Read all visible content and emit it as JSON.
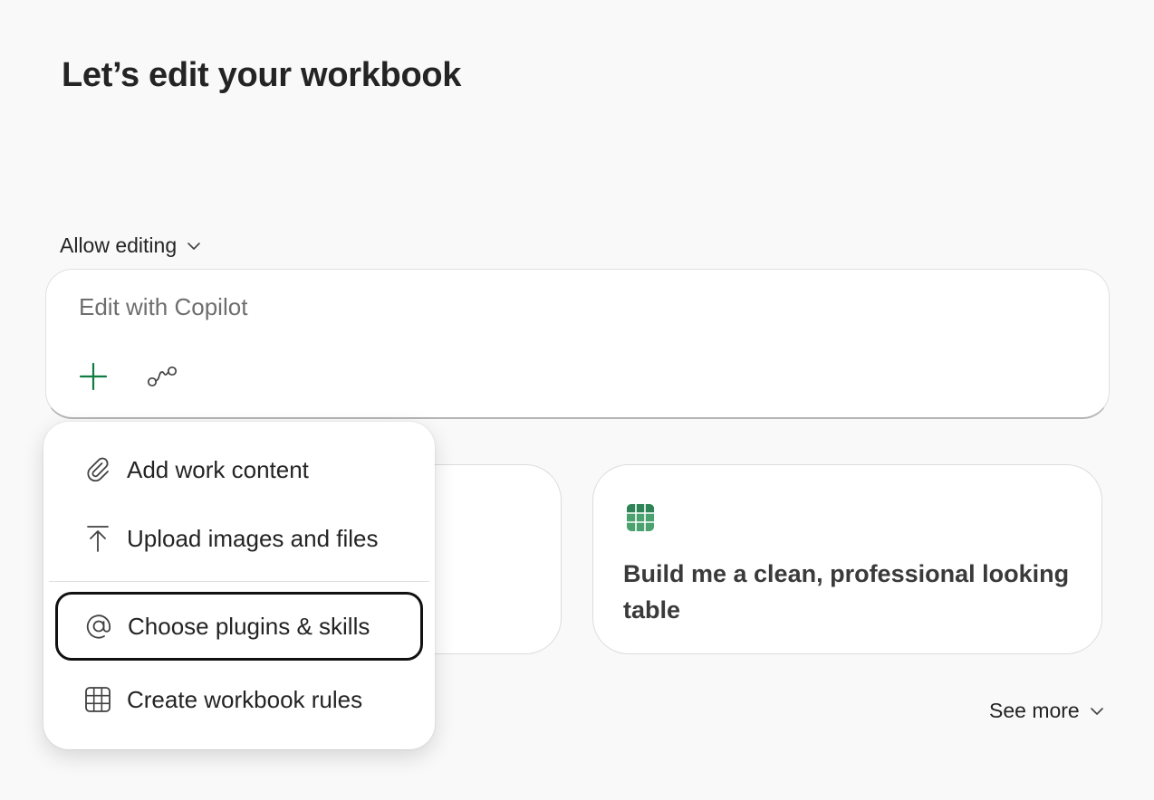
{
  "page": {
    "title": "Let’s edit your workbook"
  },
  "mode": {
    "label": "Allow editing",
    "icon": "chevron-down-icon"
  },
  "composer": {
    "placeholder": "Edit with Copilot",
    "value": "",
    "add_icon": "plus-icon",
    "flow_icon": "flow-icon",
    "accent_color": "#107c41"
  },
  "cards": [
    {
      "text": ""
    },
    {
      "icon": "grid-table-icon",
      "text": "Build me a clean, professional looking table",
      "icon_color": "#4ba26f"
    }
  ],
  "see_more": {
    "label": "See more",
    "icon": "chevron-down-icon"
  },
  "menu": {
    "items": [
      {
        "label": "Add work content",
        "icon": "paperclip-icon"
      },
      {
        "label": "Upload images and files",
        "icon": "upload-icon"
      },
      {
        "label": "Choose plugins & skills",
        "icon": "at-sign-icon",
        "focused": true
      },
      {
        "label": "Create workbook rules",
        "icon": "table-grid-icon"
      }
    ]
  }
}
